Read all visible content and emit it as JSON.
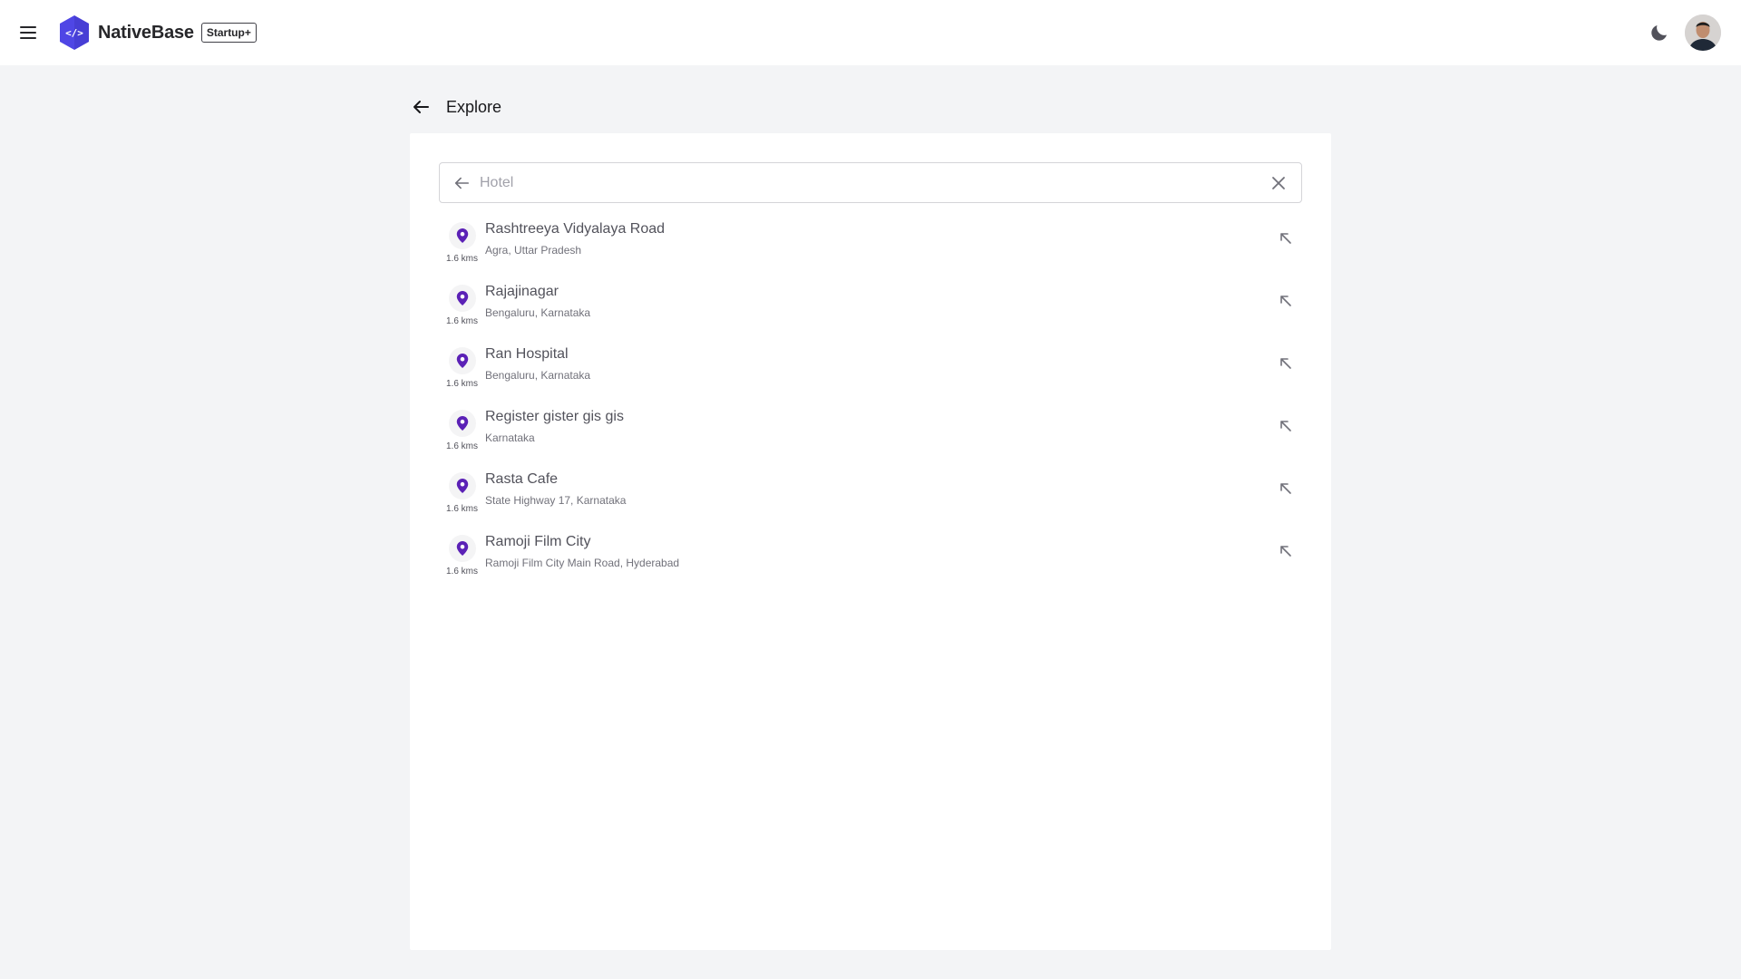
{
  "navbar": {
    "brand_name": "NativeBase",
    "badge": "Startup+",
    "menu_icon": "hamburger-menu-icon",
    "theme_icon": "moon-icon",
    "avatar_icon": "user-avatar"
  },
  "page": {
    "title": "Explore",
    "back_icon": "arrow-left-icon"
  },
  "search": {
    "value": "",
    "placeholder": "Hotel",
    "back_icon": "arrow-left-icon",
    "clear_icon": "close-icon"
  },
  "results": [
    {
      "title": "Rashtreeya Vidyalaya Road",
      "subtitle": "Agra, Uttar Pradesh",
      "distance": "1.6 kms"
    },
    {
      "title": "Rajajinagar",
      "subtitle": "Bengaluru, Karnataka",
      "distance": "1.6 kms"
    },
    {
      "title": "Ran Hospital",
      "subtitle": "Bengaluru, Karnataka",
      "distance": "1.6 kms"
    },
    {
      "title": "Register gister gis gis",
      "subtitle": "Karnataka",
      "distance": "1.6 kms"
    },
    {
      "title": "Rasta Cafe",
      "subtitle": "State Highway 17, Karnataka",
      "distance": "1.6 kms"
    },
    {
      "title": "Ramoji Film City",
      "subtitle": "Ramoji Film City Main Road, Hyderabad",
      "distance": "1.6 kms"
    }
  ],
  "colors": {
    "brand": "#4f46e5",
    "pin": "#5b21b6",
    "background": "#f3f4f6"
  }
}
